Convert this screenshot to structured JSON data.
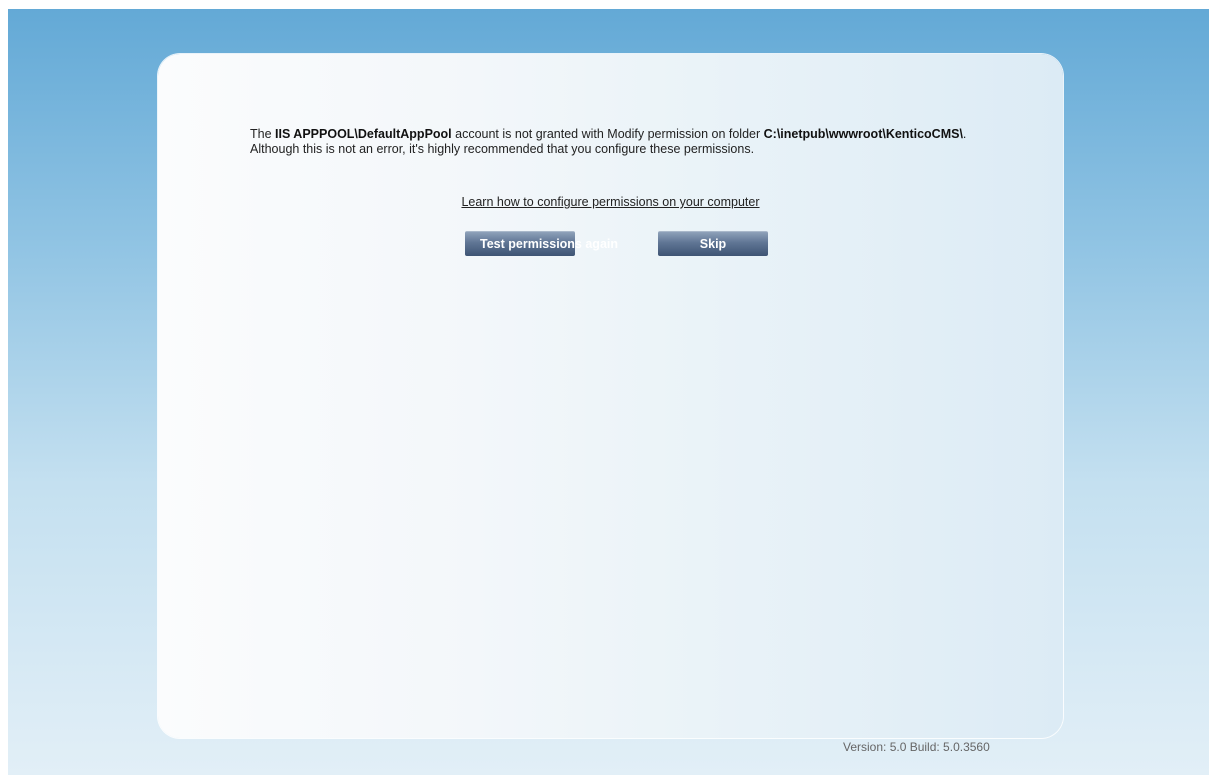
{
  "message": {
    "prefix": "The ",
    "account": "IIS APPPOOL\\DefaultAppPool",
    "middle": " account is not granted with Modify permission on folder ",
    "folder": "C:\\inetpub\\wwwroot\\KenticoCMS\\",
    "suffix": ". Although this is not an error, it's highly recommended that you configure these permissions."
  },
  "help_link": "Learn how to configure permissions on your computer",
  "buttons": {
    "test_permissions": "Test permissions again",
    "skip": "Skip"
  },
  "version_text": "Version: 5.0 Build: 5.0.3560",
  "colors": {
    "background_top": "#63a9d6",
    "panel": "#f3f7fa",
    "button": "#5f7594"
  }
}
